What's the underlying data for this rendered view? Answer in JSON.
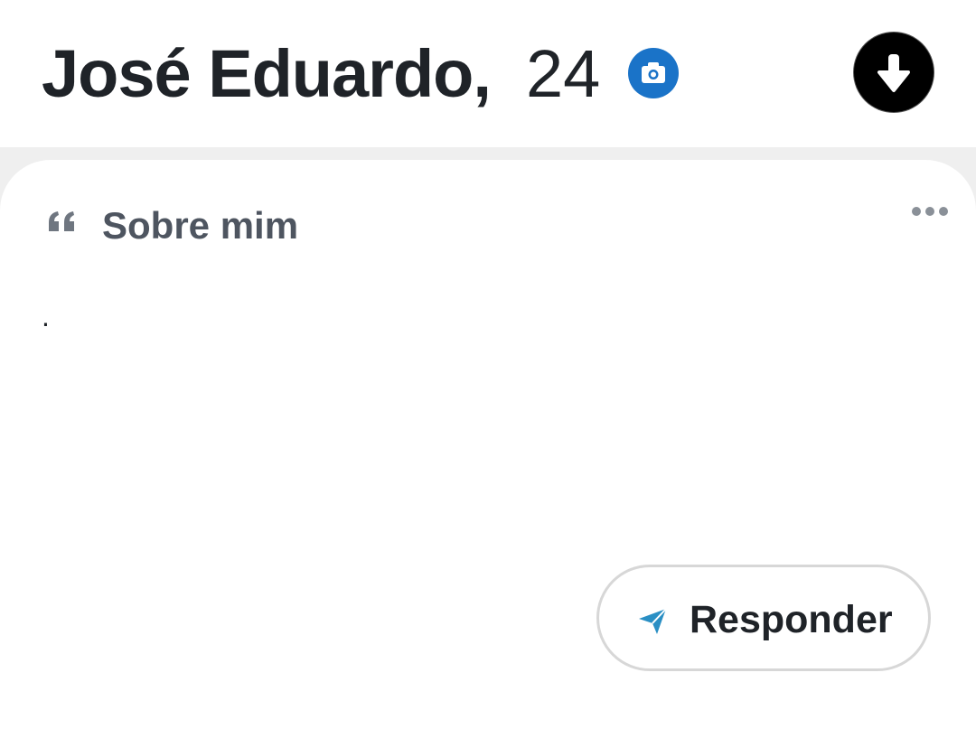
{
  "header": {
    "name": "José Eduardo,",
    "age": "24",
    "verified_icon": "camera-icon",
    "collapse_icon": "arrow-down-icon"
  },
  "section": {
    "title": "Sobre mim",
    "quote_icon": "quote-icon",
    "more_icon": "more-horizontal-icon",
    "bio": "."
  },
  "reply_button": {
    "label": "Responder",
    "icon": "send-icon"
  },
  "colors": {
    "badge": "#1a73c8",
    "send_icon": "#2a8fc4",
    "text": "#1f2328",
    "muted": "#4e5560"
  }
}
